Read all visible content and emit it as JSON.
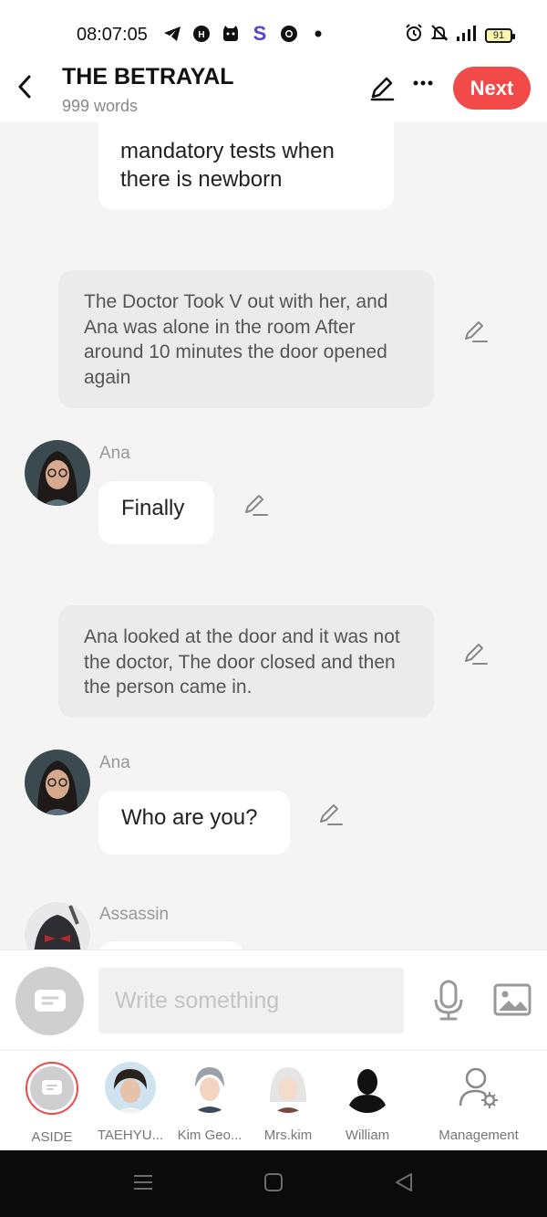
{
  "status": {
    "time": "08:07:05",
    "battery": "91",
    "left_icons": [
      "telegram-icon",
      "game-icon",
      "cat-icon",
      "s-app-icon",
      "chrome-icon",
      "dot-icon"
    ],
    "right_icons": [
      "alarm-icon",
      "mute-icon",
      "signal-icon",
      "battery-icon"
    ]
  },
  "header": {
    "title": "THE BETRAYAL",
    "word_count": "999 words",
    "next_label": "Next"
  },
  "messages": {
    "top_cut": "mandatory tests when there is newborn",
    "narration1": "The Doctor Took V out with her, and Ana was alone in the room After around 10 minutes the door opened again",
    "ana1_name": "Ana",
    "ana1_text": "Finally",
    "narration2": "Ana looked at the door and it was not the doctor, The door closed and then the person came in.",
    "ana2_name": "Ana",
    "ana2_text": "Who are you?",
    "assassin_name": "Assassin"
  },
  "composer": {
    "placeholder": "Write something"
  },
  "characters": [
    {
      "label": "ASIDE"
    },
    {
      "label": "TAEHYU..."
    },
    {
      "label": "Kim Geo..."
    },
    {
      "label": "Mrs.kim"
    },
    {
      "label": "William"
    },
    {
      "label": "Management"
    }
  ],
  "colors": {
    "accent": "#f24949",
    "background": "#f4f4f4",
    "narration_bg": "#ebebeb"
  }
}
